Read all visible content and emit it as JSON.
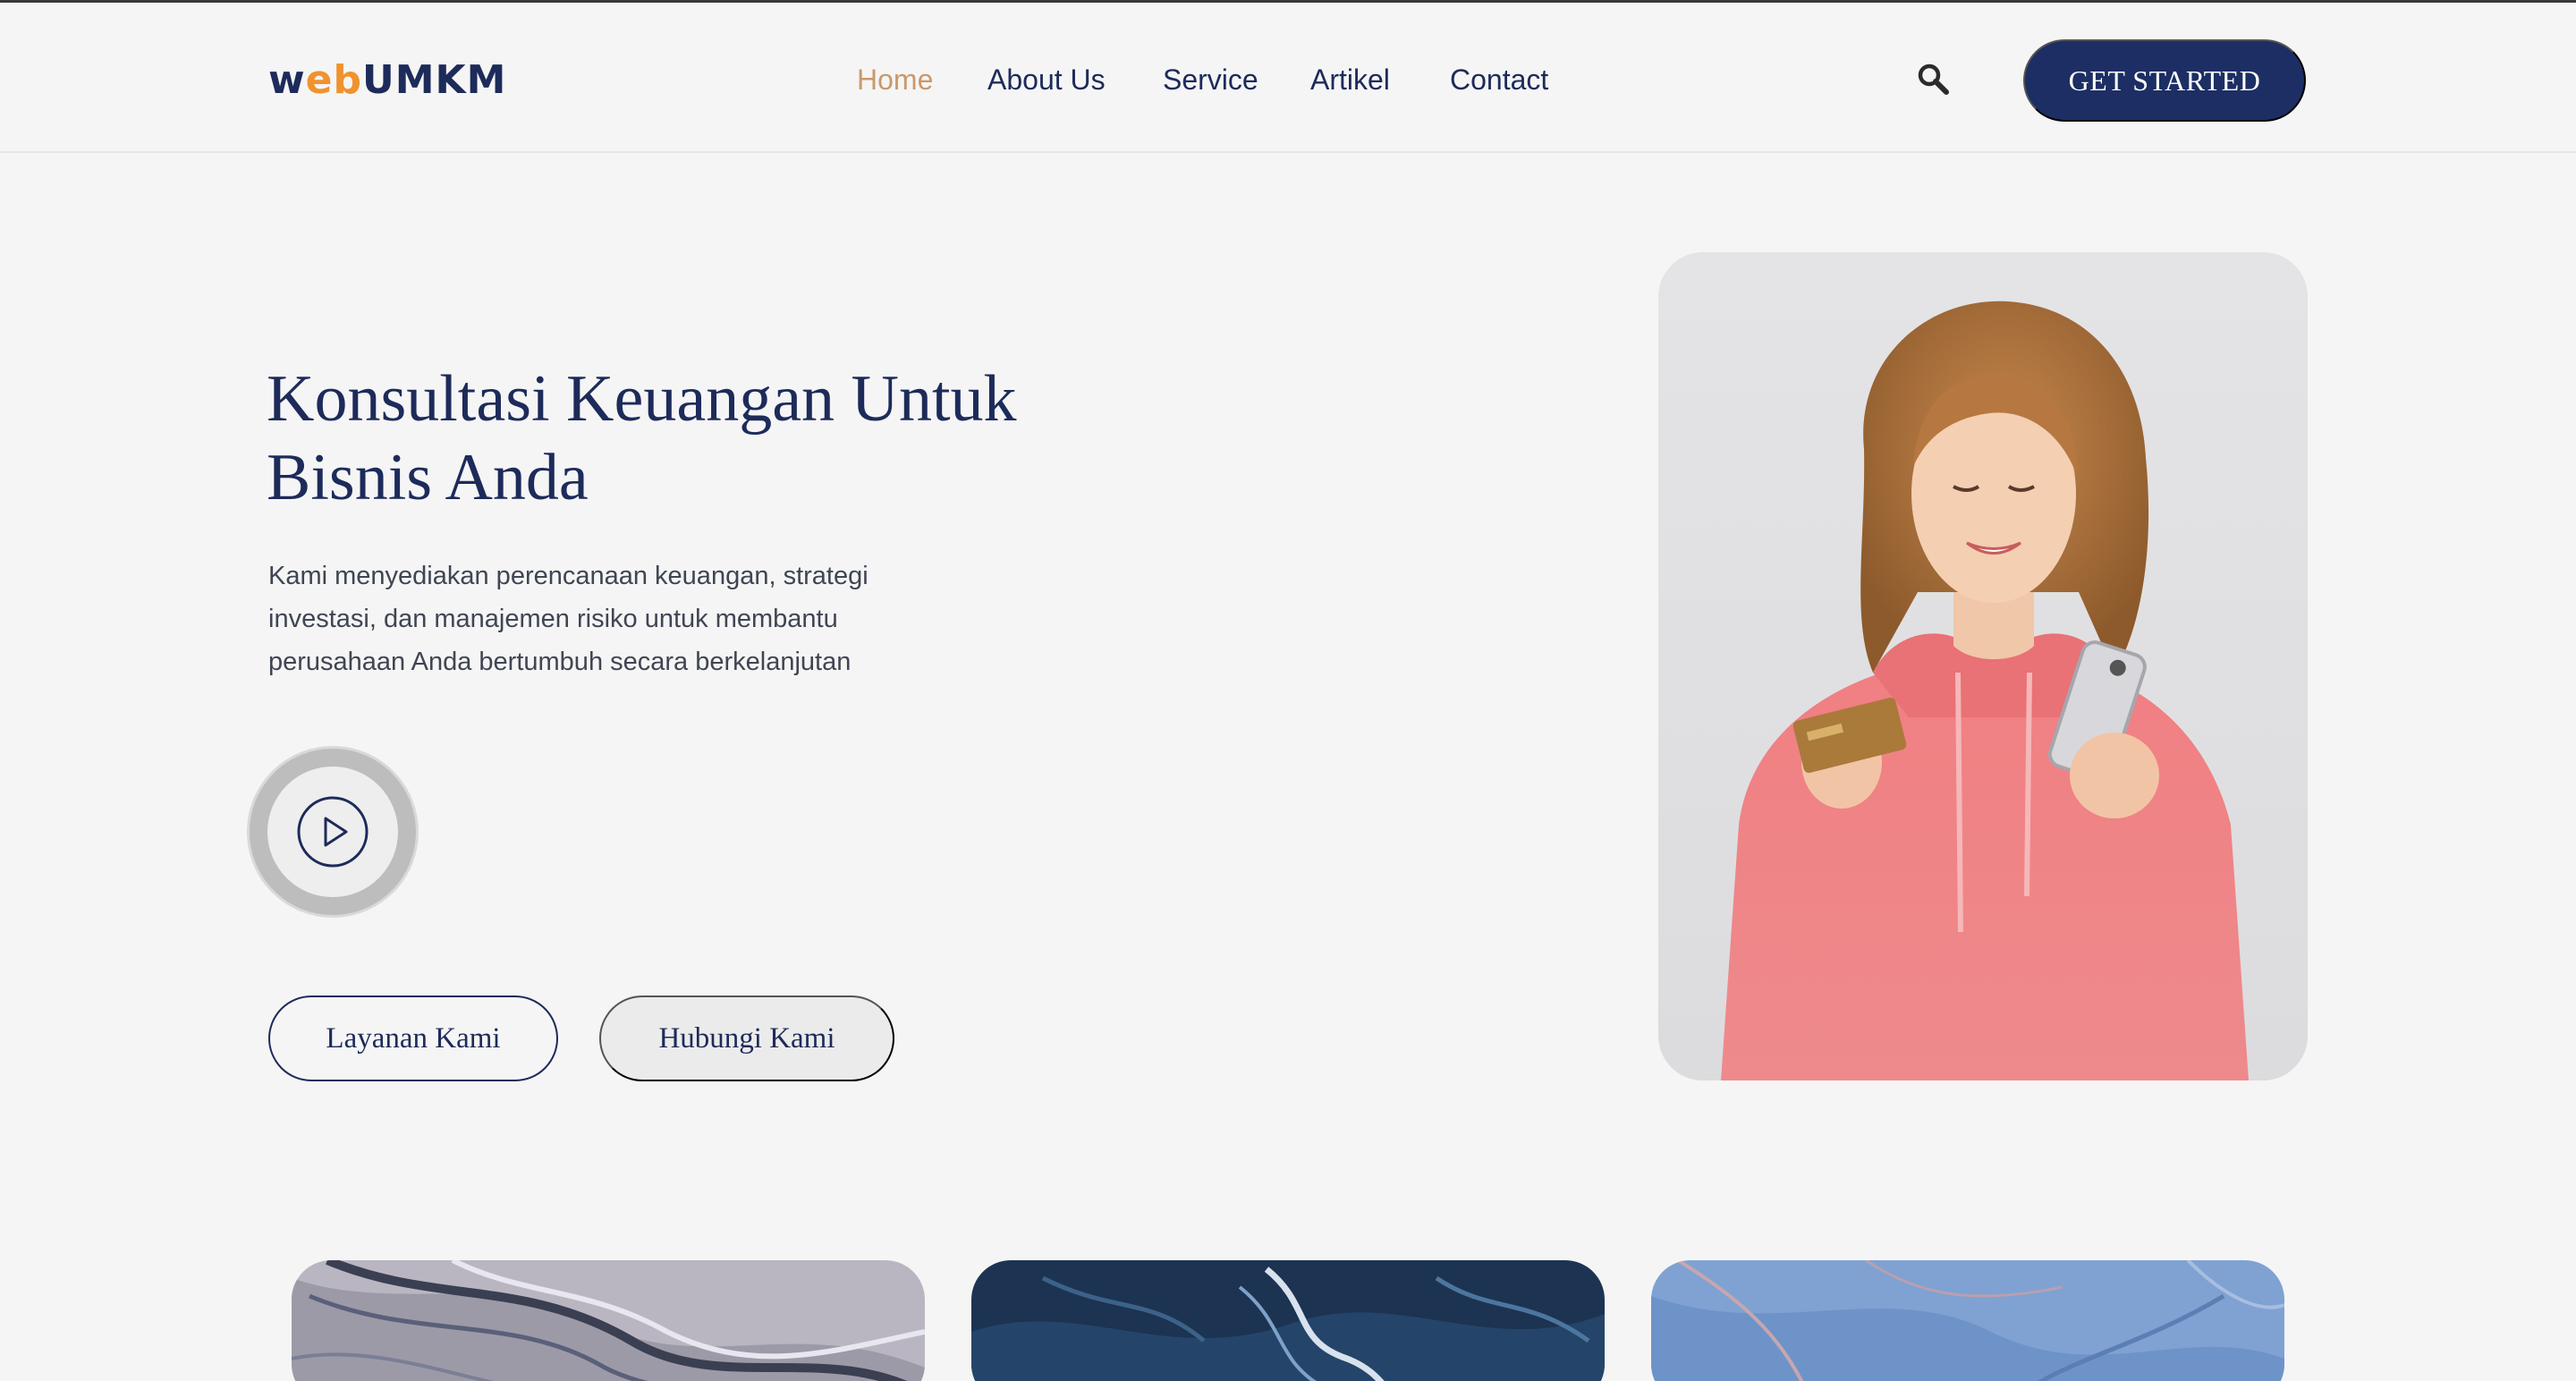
{
  "brand": {
    "logo_w": "w",
    "logo_eb": "eb",
    "logo_umkm": "UMKM",
    "accent_color": "#f0922e",
    "primary_color": "#1c2e63"
  },
  "nav": {
    "items": [
      {
        "label": "Home",
        "active": true
      },
      {
        "label": "About Us",
        "active": false
      },
      {
        "label": "Service",
        "active": false
      },
      {
        "label": "Artikel",
        "active": false
      },
      {
        "label": "Contact",
        "active": false
      }
    ],
    "active_color": "#c9996b"
  },
  "header": {
    "search_icon": "search-icon",
    "cta_label": "GET STARTED"
  },
  "hero": {
    "title": "Konsultasi Keuangan Untuk Bisnis Anda",
    "description": "Kami menyediakan perencanaan keuangan, strategi investasi, dan manajemen risiko untuk membantu perusahaan Anda bertumbuh secara berkelanjutan",
    "play_icon": "play-icon",
    "primary_button": "Layanan Kami",
    "secondary_button": "Hubungi Kami",
    "image": "woman-in-pink-hoodie-holding-credit-card-and-phone"
  },
  "cards": [
    {
      "image": "grey-marble-texture"
    },
    {
      "image": "dark-blue-marble-texture"
    },
    {
      "image": "light-blue-marble-texture"
    }
  ]
}
